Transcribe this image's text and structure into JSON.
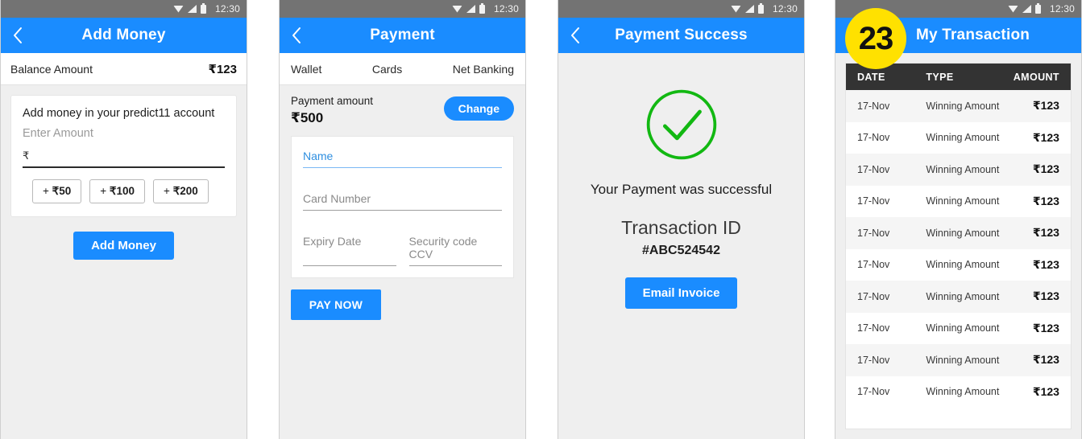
{
  "statusbar": {
    "time": "12:30",
    "icons": [
      "wifi-icon",
      "signal-icon",
      "battery-icon"
    ]
  },
  "colors": {
    "accent_blue": "#1a8cff",
    "success_green": "#12b812",
    "badge_yellow": "#ffe100",
    "table_header": "#333333",
    "page_bg": "#efefef"
  },
  "screen1": {
    "title": "Add Money",
    "back_icon": "chevron-left-icon",
    "balance_label": "Balance Amount",
    "balance_value": "₹123",
    "card_title": "Add money in your predict11 account",
    "input_label": "Enter Amount",
    "input_prefix": "₹",
    "input_value": "",
    "chips": [
      {
        "plus": "+",
        "amount": "₹50"
      },
      {
        "plus": "+",
        "amount": "₹100"
      },
      {
        "plus": "+",
        "amount": "₹200"
      }
    ],
    "submit_label": "Add Money"
  },
  "screen2": {
    "title": "Payment",
    "back_icon": "chevron-left-icon",
    "tabs": [
      {
        "label": "Wallet"
      },
      {
        "label": "Cards"
      },
      {
        "label": "Net Banking"
      }
    ],
    "pay_label": "Payment amount",
    "pay_amount": "₹500",
    "change_label": "Change",
    "fields": {
      "name": "Name",
      "card_number": "Card Number",
      "expiry": "Expiry Date",
      "cvv": "Security code CCV"
    },
    "pay_now_label": "PAY NOW"
  },
  "screen3": {
    "title": "Payment Success",
    "back_icon": "chevron-left-icon",
    "check_icon": "check-circle-icon",
    "message": "Your Payment was successful",
    "txn_label": "Transaction ID",
    "txn_id": "#ABC524542",
    "email_label": "Email Invoice"
  },
  "screen4": {
    "title": "My Transaction",
    "badge": "23",
    "columns": {
      "date": "DATE",
      "type": "TYPE",
      "amount": "AMOUNT"
    },
    "rows": [
      {
        "date": "17-Nov",
        "type": "Winning Amount",
        "amount": "₹123"
      },
      {
        "date": "17-Nov",
        "type": "Winning Amount",
        "amount": "₹123"
      },
      {
        "date": "17-Nov",
        "type": "Winning Amount",
        "amount": "₹123"
      },
      {
        "date": "17-Nov",
        "type": "Winning Amount",
        "amount": "₹123"
      },
      {
        "date": "17-Nov",
        "type": "Winning Amount",
        "amount": "₹123"
      },
      {
        "date": "17-Nov",
        "type": "Winning Amount",
        "amount": "₹123"
      },
      {
        "date": "17-Nov",
        "type": "Winning Amount",
        "amount": "₹123"
      },
      {
        "date": "17-Nov",
        "type": "Winning Amount",
        "amount": "₹123"
      },
      {
        "date": "17-Nov",
        "type": "Winning Amount",
        "amount": "₹123"
      },
      {
        "date": "17-Nov",
        "type": "Winning Amount",
        "amount": "₹123"
      }
    ]
  }
}
